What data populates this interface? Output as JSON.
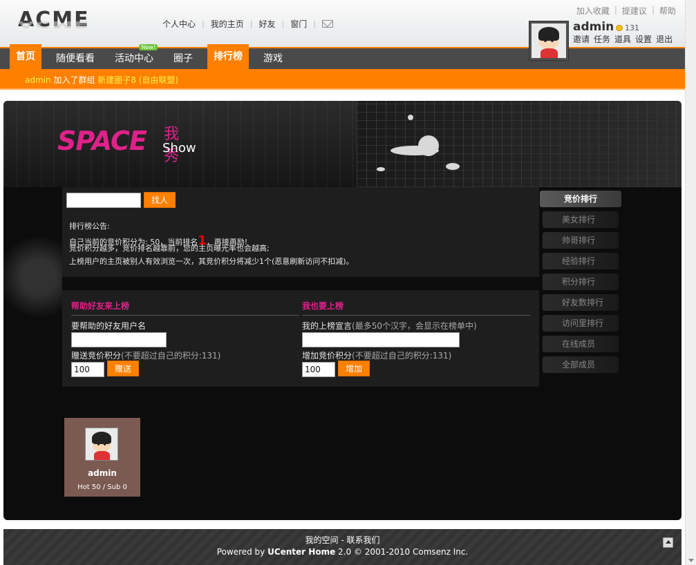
{
  "header": {
    "logo_text": "ACME",
    "topnav": [
      "个人中心",
      "我的主页",
      "好友",
      "窗门"
    ],
    "toplinks": [
      "加入收藏",
      "提建议",
      "帮助"
    ],
    "username": "admin",
    "coins": "131",
    "userlinks": [
      "邀请",
      "任务",
      "道具",
      "设置",
      "退出"
    ]
  },
  "mainnav": {
    "items": [
      "首页",
      "随便看看",
      "活动中心",
      "圈子",
      "排行榜",
      "游戏"
    ],
    "new_badge": "New!"
  },
  "feed": {
    "user": "admin",
    "action": "加入了群组",
    "group": "新建圈子8 (自由联盟)"
  },
  "space": {
    "logo_big": "SPACE",
    "logo_cn": "我秀",
    "logo_en": "Show",
    "search_button": "找人",
    "notice_title": "排行榜公告:",
    "notice_line1_a": "自己当前的竞价积分为: 50，当前排名",
    "notice_rank": "1",
    "notice_line1_b": "，再接再励!",
    "notice_line2": "竞价积分越多，竞价排名越靠前，您的主页曝光率也会越高;",
    "notice_line3": "上榜用户的主页被别人有效浏览一次，其竞价积分将减少1个(恶意刷新访问不扣减)。",
    "help_title": "帮助好友来上榜",
    "help_user_label": "要帮助的好友用户名",
    "help_points_label": "赠送竞价积分",
    "help_points_hint": "(不要超过自己的积分:131)",
    "help_points_value": "100",
    "help_button": "赠送",
    "self_title": "我也要上榜",
    "self_decl_label": "我的上榜宣言",
    "self_decl_hint": "(最多50个汉字，会显示在榜单中)",
    "self_points_label": "增加竞价积分",
    "self_points_hint": "(不要超过自己的积分:131)",
    "self_points_value": "100",
    "self_button": "增加",
    "side_head": "竞价排行",
    "side_items": [
      "美女排行",
      "帅哥排行",
      "经验排行",
      "积分排行",
      "好友数排行",
      "访问里排行",
      "在线成员",
      "全部成员"
    ],
    "member": {
      "name": "admin",
      "stats": "Hot 50 / Sub 0"
    }
  },
  "footer": {
    "link1": "我的空间",
    "sep": " - ",
    "link2": "联系我们",
    "powered_a": "Powered by ",
    "powered_b": "UCenter Home",
    "powered_c": " 2.0 © 2001-2010 Comsenz Inc."
  }
}
